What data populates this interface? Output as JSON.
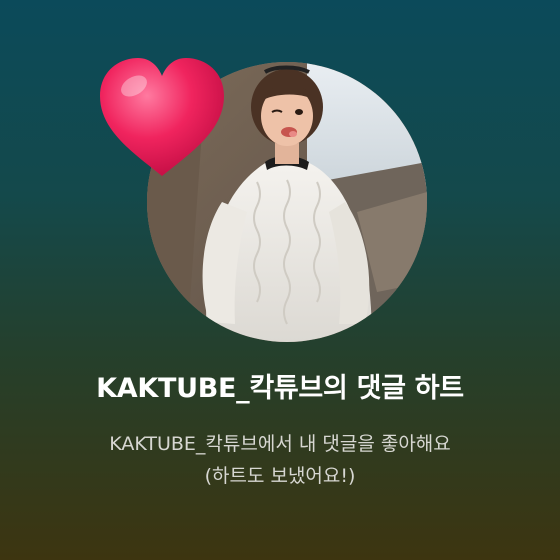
{
  "notification": {
    "title": "KAKTUBE_칵튜브의 댓글 하트",
    "message_line1": "KAKTUBE_칵튜브에서 내 댓글을 좋아해요",
    "message_line2": "(하트도 보냈어요!)",
    "heart_icon": "heart-icon",
    "colors": {
      "heart": "#f0245e",
      "title": "#ffffff",
      "message": "#d7d7d2",
      "background_top": "#0b4a5a",
      "background_bottom": "#3d3510"
    }
  }
}
